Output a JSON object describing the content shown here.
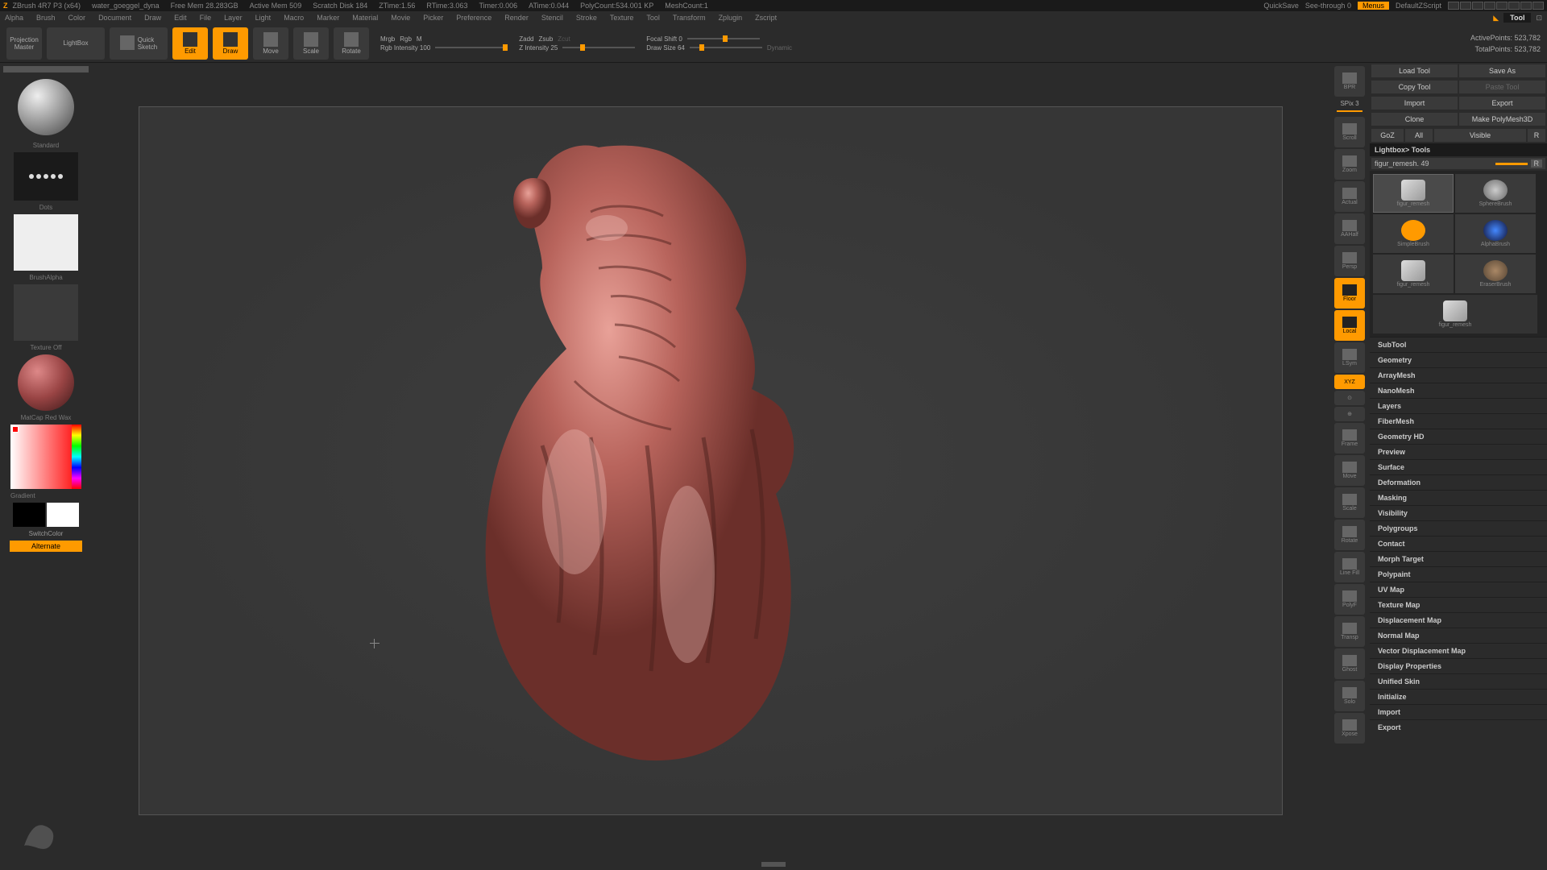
{
  "title": {
    "app": "ZBrush 4R7 P3 (x64)",
    "doc": "water_goeggel_dyna",
    "freemem": "Free Mem 28.283GB",
    "activemem": "Active Mem 509",
    "scratch": "Scratch Disk 184",
    "ztime": "ZTime:1.56",
    "rtime": "RTime:3.063",
    "timer": "Timer:0.006",
    "atime": "ATime:0.044",
    "polycount": "PolyCount:534.001 KP",
    "meshcount": "MeshCount:1",
    "quicksave": "QuickSave",
    "seethrough": "See-through  0",
    "menus": "Menus",
    "script": "DefaultZScript"
  },
  "menus": [
    "Alpha",
    "Brush",
    "Color",
    "Document",
    "Draw",
    "Edit",
    "File",
    "Layer",
    "Light",
    "Macro",
    "Marker",
    "Material",
    "Movie",
    "Picker",
    "Preference",
    "Render",
    "Stencil",
    "Stroke",
    "Texture",
    "Tool",
    "Transform",
    "Zplugin",
    "Zscript"
  ],
  "tool_label": "Tool",
  "shelf": {
    "projection": "Projection\nMaster",
    "lightbox": "LightBox",
    "quicksketch": "Quick\nSketch",
    "edit": "Edit",
    "draw": "Draw",
    "move": "Move",
    "scale": "Scale",
    "rotate": "Rotate",
    "mrgb": "Mrgb",
    "rgb": "Rgb",
    "m": "M",
    "rgb_intensity": "Rgb Intensity 100",
    "zadd": "Zadd",
    "zsub": "Zsub",
    "zcut": "Zcut",
    "z_intensity": "Z Intensity 25",
    "focal": "Focal Shift 0",
    "drawsize": "Draw Size 64",
    "dynamic": "Dynamic",
    "active": "ActivePoints: 523,782",
    "total": "TotalPoints: 523,782"
  },
  "left": {
    "standard": "Standard",
    "dots": "Dots",
    "brushalpha": "BrushAlpha",
    "texture": "Texture Off",
    "material": "MatCap Red Wax",
    "gradient": "Gradient",
    "switch": "SwitchColor",
    "alternate": "Alternate"
  },
  "rightstrip": {
    "spix": "SPix 3",
    "items": [
      "BPR",
      "Scroll",
      "Zoom",
      "Actual",
      "AAHalf",
      "Persp",
      "Floor",
      "Local",
      "LSym",
      "XYZ",
      "",
      "",
      "Frame",
      "Move",
      "Scale",
      "Rotate",
      "Line Fill",
      "PolyF",
      "Transp",
      "Ghost",
      "Solo",
      "Xpose"
    ]
  },
  "palette": {
    "row1": [
      "Load Tool",
      "Save As"
    ],
    "row2": [
      "Copy Tool",
      "Paste Tool"
    ],
    "row3": [
      "Import",
      "Export"
    ],
    "row4": [
      "Clone",
      "Make PolyMesh3D"
    ],
    "row5": [
      "GoZ",
      "All",
      "Visible",
      "R"
    ],
    "lightbox": "Lightbox> Tools",
    "toolname": "figur_remesh. 49",
    "r": "R",
    "thumbs": [
      "figur_remesh",
      "SphereBrush",
      "SimpleBrush",
      "AlphaBrush",
      "figur_remesh",
      "EraserBrush",
      "figur_remesh"
    ],
    "sections": [
      "SubTool",
      "Geometry",
      "ArrayMesh",
      "NanoMesh",
      "Layers",
      "FiberMesh",
      "Geometry HD",
      "Preview",
      "Surface",
      "Deformation",
      "Masking",
      "Visibility",
      "Polygroups",
      "Contact",
      "Morph Target",
      "Polypaint",
      "UV Map",
      "Texture Map",
      "Displacement Map",
      "Normal Map",
      "Vector Displacement Map",
      "Display Properties",
      "Unified Skin",
      "Initialize",
      "Import",
      "Export"
    ]
  }
}
